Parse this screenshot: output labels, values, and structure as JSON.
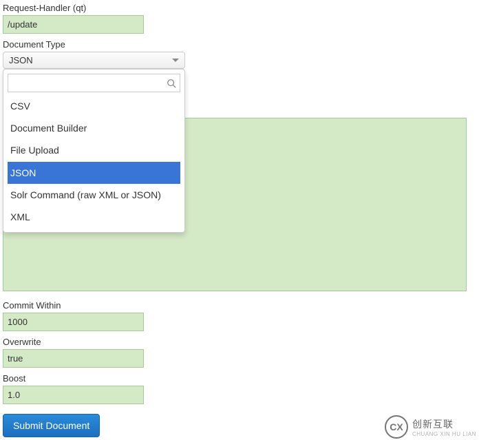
{
  "requestHandler": {
    "label": "Request-Handler (qt)",
    "value": "/update"
  },
  "documentType": {
    "label": "Document Type",
    "selected": "JSON",
    "options": {
      "0": "CSV",
      "1": "Document Builder",
      "2": "File Upload",
      "3": "JSON",
      "4": "Solr Command (raw XML or JSON)",
      "5": "XML"
    },
    "searchPlaceholder": ""
  },
  "commitWithin": {
    "label": "Commit Within",
    "value": "1000"
  },
  "overwrite": {
    "label": "Overwrite",
    "value": "true"
  },
  "boost": {
    "label": "Boost",
    "value": "1.0"
  },
  "documentBody": {
    "value": ""
  },
  "submit": {
    "label": "Submit Document"
  },
  "watermark": {
    "logo": "CX",
    "main": "创新互联",
    "sub": "CHUANG XIN HU LIAN"
  }
}
